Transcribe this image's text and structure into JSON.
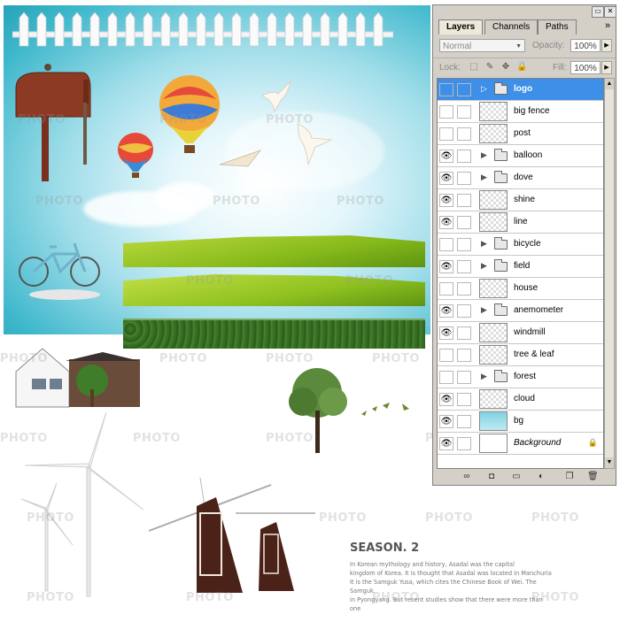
{
  "canvas": {
    "watermark_text": "PHOTO",
    "season_title": "SEASON. 2",
    "season_lines": [
      "In Korean mythology and history, Asadal was the capital",
      "kingdom of Korea. It is thought that Asadal was located in Manchuria",
      "It is the Samguk Yusa, which cites the Chinese Book of Wei. The Samguk",
      "in Pyongyang. But recent studies show that there were more than one"
    ]
  },
  "panel": {
    "tabs": [
      "Layers",
      "Channels",
      "Paths"
    ],
    "active_tab": "Layers",
    "menu_glyph": "»",
    "blend_mode": "Normal",
    "opacity_label": "Opacity:",
    "opacity_value": "100%",
    "lock_label": "Lock:",
    "fill_label": "Fill:",
    "fill_value": "100%",
    "layers": [
      {
        "name": "logo",
        "type": "group",
        "visible": false,
        "selected": true
      },
      {
        "name": "big fence",
        "type": "layer",
        "visible": false
      },
      {
        "name": "post",
        "type": "layer",
        "visible": false
      },
      {
        "name": "balloon",
        "type": "group",
        "visible": true
      },
      {
        "name": "dove",
        "type": "group",
        "visible": true
      },
      {
        "name": "shine",
        "type": "layer",
        "visible": true
      },
      {
        "name": "line",
        "type": "layer",
        "visible": true
      },
      {
        "name": "bicycle",
        "type": "group",
        "visible": false
      },
      {
        "name": "field",
        "type": "group",
        "visible": true
      },
      {
        "name": "house",
        "type": "layer",
        "visible": false
      },
      {
        "name": "anemometer",
        "type": "group",
        "visible": true
      },
      {
        "name": "windmill",
        "type": "layer",
        "visible": true
      },
      {
        "name": "tree & leaf",
        "type": "layer",
        "visible": false
      },
      {
        "name": "forest",
        "type": "group",
        "visible": false
      },
      {
        "name": "cloud",
        "type": "layer",
        "visible": true
      },
      {
        "name": "bg",
        "type": "layer",
        "visible": true
      },
      {
        "name": "Background",
        "type": "background",
        "visible": true
      }
    ]
  }
}
